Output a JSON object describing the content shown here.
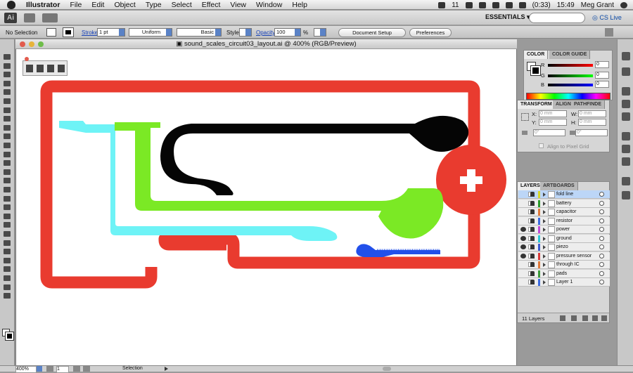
{
  "menubar": {
    "app_name": "Illustrator",
    "items": [
      "File",
      "Edit",
      "Object",
      "Type",
      "Select",
      "Effect",
      "View",
      "Window",
      "Help"
    ],
    "battery": "(0:33)",
    "time": "15:49",
    "user": "Meg Grant",
    "badge": "11"
  },
  "appbar": {
    "logo": "Ai",
    "workspace": "ESSENTIALS",
    "cs_live": "CS Live"
  },
  "control": {
    "selection": "No Selection",
    "stroke_label": "Stroke",
    "stroke_weight": "1 pt",
    "profile": "Uniform",
    "brush": "Basic",
    "style_label": "Style",
    "opacity_label": "Opacity",
    "opacity_value": "100",
    "percent": "%",
    "doc_setup": "Document Setup",
    "preferences": "Preferences"
  },
  "document": {
    "title": "sound_scales_circuit03_layout.ai @ 400% (RGB/Preview)"
  },
  "color_panel": {
    "tabs": [
      "COLOR",
      "COLOR GUIDE"
    ],
    "channels": [
      {
        "label": "R",
        "value": "0"
      },
      {
        "label": "G",
        "value": "0"
      },
      {
        "label": "B",
        "value": "0"
      }
    ]
  },
  "transform_panel": {
    "tabs": [
      "TRANSFORM",
      "ALIGN",
      "PATHFINDE"
    ],
    "x_label": "X:",
    "x_value": "0 mm",
    "y_label": "Y:",
    "y_value": "0 mm",
    "w_label": "W:",
    "w_value": "0 mm",
    "h_label": "H:",
    "h_value": "0 mm",
    "angle1": "0°",
    "angle2": "0°",
    "align_pixel": "Align to Pixel Grid"
  },
  "layers_panel": {
    "tabs": [
      "LAYERS",
      "ARTBOARDS"
    ],
    "layers": [
      {
        "name": "fold line",
        "color": "#d8d82a"
      },
      {
        "name": "battery",
        "color": "#2a9a2a"
      },
      {
        "name": "capacitor",
        "color": "#e07a3a"
      },
      {
        "name": "resistor",
        "color": "#3a6ae0"
      },
      {
        "name": "power",
        "color": "#c04ad8"
      },
      {
        "name": "ground",
        "color": "#2ac8d8"
      },
      {
        "name": "piezo",
        "color": "#3a5ad0"
      },
      {
        "name": "pressure sensor",
        "color": "#d83a3a"
      },
      {
        "name": "through IC",
        "color": "#e07a3a"
      },
      {
        "name": "pads",
        "color": "#3a9a3a"
      },
      {
        "name": "Layer 1",
        "color": "#3a6ae0"
      }
    ],
    "footer": "11 Layers"
  },
  "status": {
    "zoom": "400%",
    "page": "1",
    "tool": "Selection"
  },
  "artwork_colors": {
    "red": "#e93b2f",
    "black": "#050505",
    "green": "#7be925",
    "cyan": "#6ef3f6",
    "blue": "#2250ea"
  }
}
